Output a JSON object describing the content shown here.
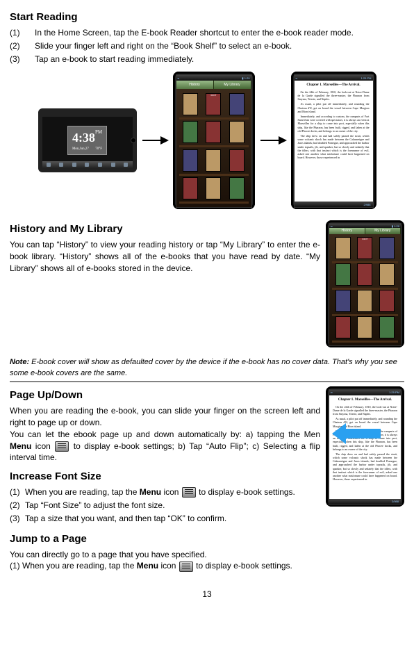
{
  "s1": {
    "title": "Start Reading",
    "steps": [
      {
        "n": "(1)",
        "t": "In the Home Screen, tap the E-book Reader shortcut to enter the e-book reader mode."
      },
      {
        "n": "(2)",
        "t": "Slide your finger left and right on the “Book Shelf” to select an e-book."
      },
      {
        "n": "(3)",
        "t": "Tap an e-book to start reading immediately."
      }
    ]
  },
  "tablet": {
    "time": "4:38",
    "ampm": "PM",
    "day": "Mon,Jun,27",
    "temp": "70°F"
  },
  "shelf": {
    "tab1": "History",
    "tab2": "My Library"
  },
  "reader": {
    "status_time": "1:29 PM",
    "chapter": "Chapter 1. Marseilles—The Arrival.",
    "p1": "On the 24th of February, 1810, the look-out at Notre-Dame de la Garde signalled the three-master, the Pharaon from Smyrna, Trieste, and Naples.",
    "p2": "As usual, a pilot put off immediately, and rounding the Chateau d'If, got on board the vessel between Cape Morgion and Rion island.",
    "p3": "Immediately, and according to custom, the ramparts of Fort Saint-Jean were covered with spectators; it is always an event at Marseilles for a ship to come into port, especially when this ship, like the Pharaon, has been built, rigged, and laden at the old Phocee docks, and belongs to an owner of the city.",
    "p4": "The ship drew on and had safely passed the strait, which some volcanic shock has made between the Calasareigne and Jaros islands; had doubled Pomegue, and approached the harbor under topsails, jib, and spanker, but so slowly and sedately that the idlers, with that instinct which is the forerunner of evil, asked one another what misfortune could have happened on board. However, those experienced in",
    "footer": "2/988"
  },
  "s2": {
    "title": "History and My Library",
    "body": "You can tap “History” to view your reading history or tap “My Library” to enter the e-book library. “History” shows all of the e-books that you have read by date. “My Library” shows all of e-books stored in the device."
  },
  "note": {
    "label": "Note:",
    "body": " E-book cover will show as defaulted cover by the device if the e-book has no cover data. That's why you see some e-book covers are the same."
  },
  "s3": {
    "title": "Page Up/Down",
    "p1": "When you are reading the e-book, you can slide your finger on the screen left and right to page up or down.",
    "p2a": "You can let the ebook page up and down automatically by: a) tapping the Men ",
    "p2b": "Menu",
    "p2c": " icon ",
    "p2d": " to display e-book settings; b) Tap “Auto Flip”; c) Selecting a flip interval time."
  },
  "s4": {
    "title": "Increase Font Size",
    "items": [
      {
        "n": "(1)",
        "a": "When you are reading, tap the ",
        "b": "Menu",
        "c": " icon ",
        "d": " to display e-book settings."
      },
      {
        "n": "(2)",
        "t": "Tap “Font Size” to adjust the font size."
      },
      {
        "n": "(3)",
        "t": "Tap a size that you want, and then tap “OK” to confirm."
      }
    ]
  },
  "s5": {
    "title": "Jump to a Page",
    "p1": "You can directly go to a page that you have specified.",
    "p2a": "(1) When you are reading, tap the ",
    "p2b": "Menu",
    "p2c": " icon ",
    "p2d": " to display e-book settings."
  },
  "pagenum": "13"
}
